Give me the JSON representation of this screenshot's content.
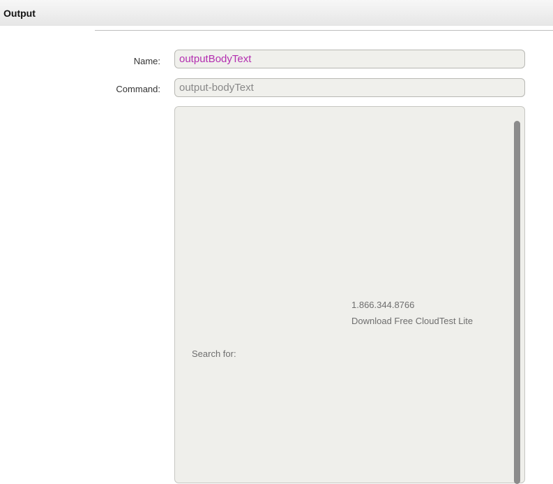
{
  "header": {
    "title": "Output"
  },
  "form": {
    "name": {
      "label": "Name:",
      "value": "outputBodyText"
    },
    "command": {
      "label": "Command:",
      "value": "output-bodyText"
    },
    "body": {
      "lines": [
        "1.866.344.8766",
        "Download Free CloudTest Lite",
        "Search for:"
      ]
    }
  },
  "colors": {
    "name_value": "#b32eb0",
    "command_value": "#888888",
    "field_background": "#f0f0ec"
  }
}
